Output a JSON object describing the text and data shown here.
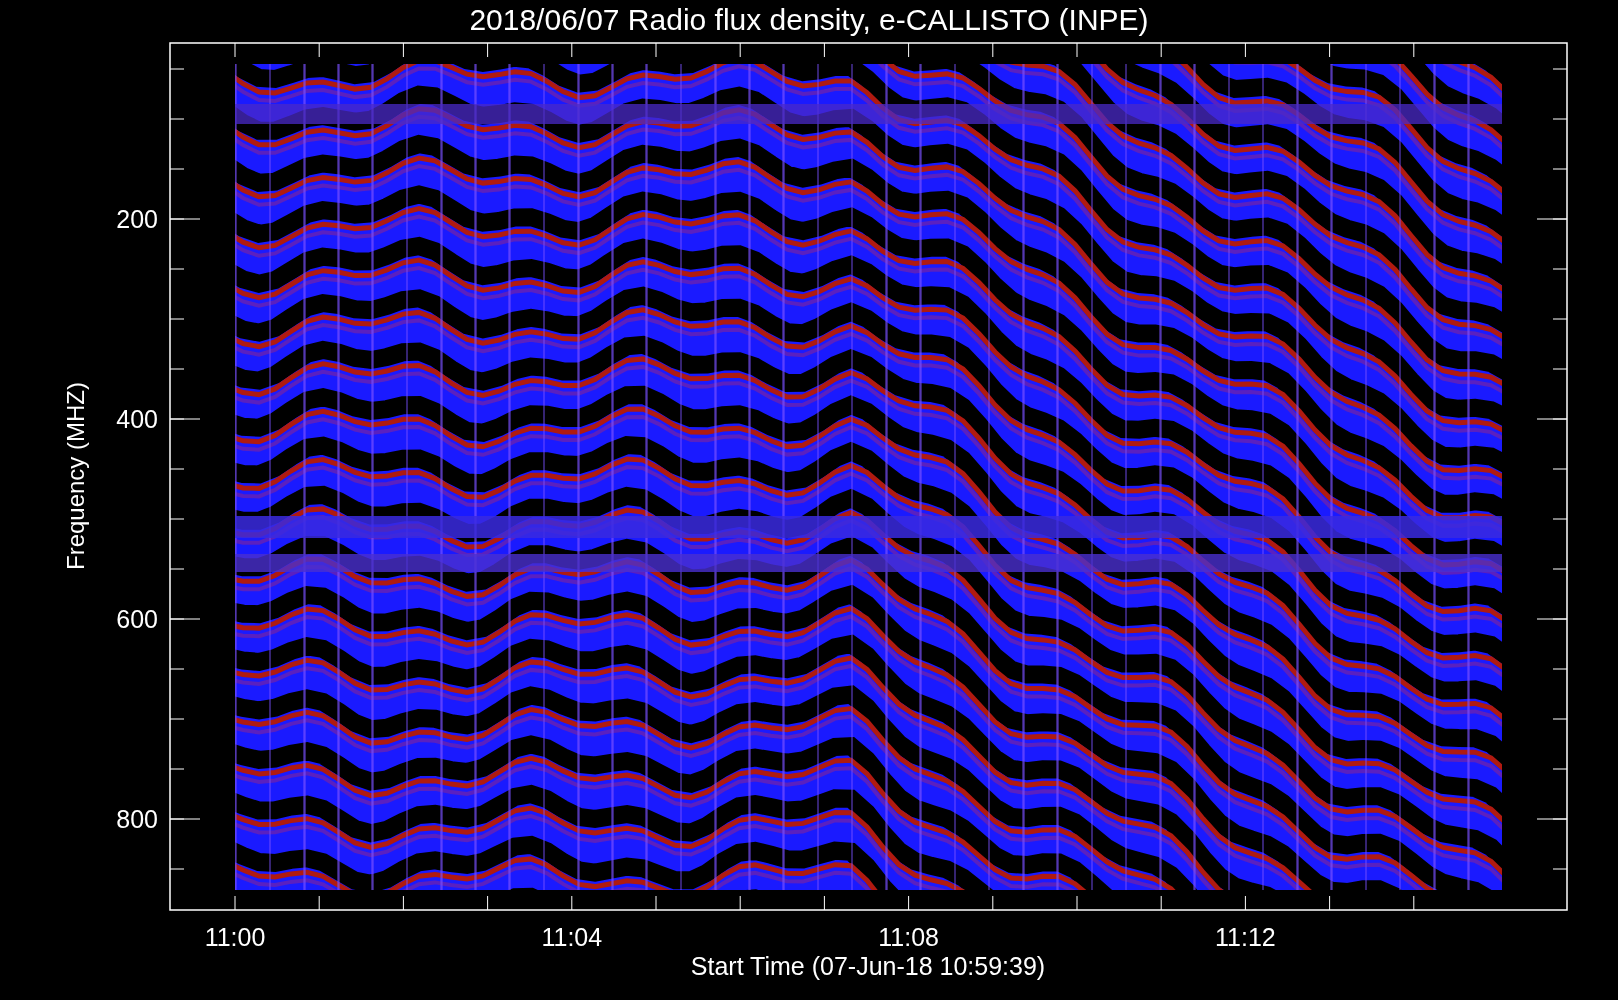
{
  "title": "2018/06/07  Radio flux density, e-CALLISTO (INPE)",
  "y_axis": {
    "label": "Frequency (MHZ)",
    "ticks": [
      "200",
      "400",
      "600",
      "800"
    ]
  },
  "x_axis": {
    "label": "Start Time (07-Jun-18 10:59:39)",
    "ticks": [
      "11:00",
      "11:04",
      "11:08",
      "11:12"
    ]
  }
}
